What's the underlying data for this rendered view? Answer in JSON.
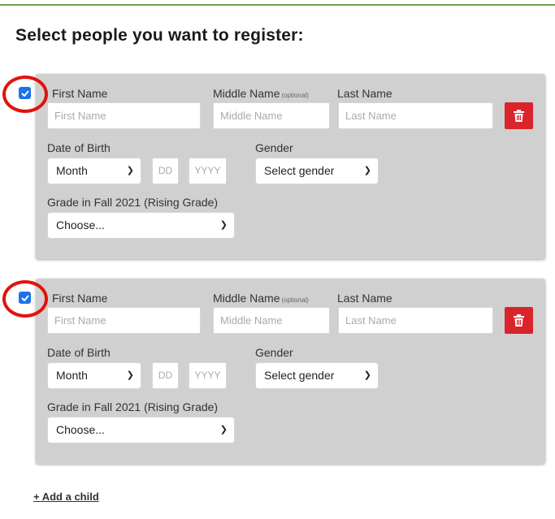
{
  "page": {
    "title": "Select people you want to register:"
  },
  "children": [
    {
      "checked": true,
      "first_name_label": "First Name",
      "first_name_placeholder": "First Name",
      "middle_name_label": "Middle Name",
      "middle_name_optional": "(optional)",
      "middle_name_placeholder": "Middle Name",
      "last_name_label": "Last Name",
      "last_name_placeholder": "Last Name",
      "dob_label": "Date of Birth",
      "month_value": "Month",
      "day_placeholder": "DD",
      "year_placeholder": "YYYY",
      "gender_label": "Gender",
      "gender_value": "Select gender",
      "grade_label": "Grade in Fall 2021 (Rising Grade)",
      "grade_value": "Choose..."
    },
    {
      "checked": true,
      "first_name_label": "First Name",
      "first_name_placeholder": "First Name",
      "middle_name_label": "Middle Name",
      "middle_name_optional": "(optional)",
      "middle_name_placeholder": "Middle Name",
      "last_name_label": "Last Name",
      "last_name_placeholder": "Last Name",
      "dob_label": "Date of Birth",
      "month_value": "Month",
      "day_placeholder": "DD",
      "year_placeholder": "YYYY",
      "gender_label": "Gender",
      "gender_value": "Select gender",
      "grade_label": "Grade in Fall 2021 (Rising Grade)",
      "grade_value": "Choose..."
    }
  ],
  "add_child_label": "+ Add a child",
  "colors": {
    "accent_rule": "#6ea34a",
    "delete_button": "#d9242b",
    "checkbox": "#1a73e8",
    "highlight_ring": "#e3120b"
  },
  "icons": {
    "delete": "trash-icon",
    "checkbox": "checkmark-icon",
    "select": "chevron-down-icon"
  }
}
